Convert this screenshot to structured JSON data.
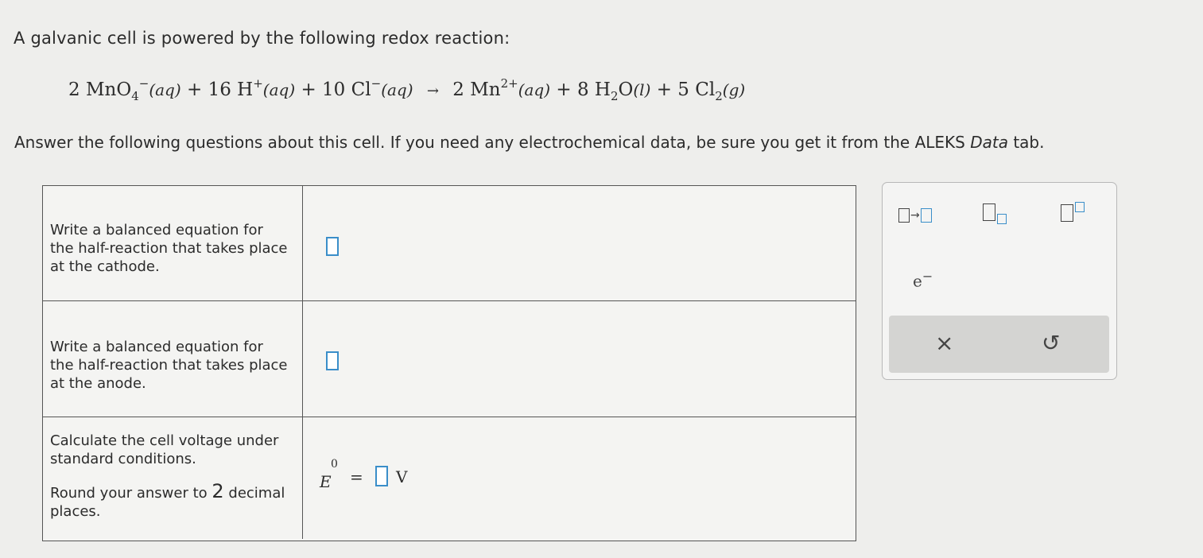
{
  "intro": "A galvanic cell is powered by the following redox reaction:",
  "reaction": {
    "r1_coef": "2",
    "r1_formula": "MnO",
    "r1_sub": "4",
    "r1_sup": "−",
    "r1_state": "(aq)",
    "plus1": "+",
    "r2_coef": "16",
    "r2_formula": "H",
    "r2_sup": "+",
    "r2_state": "(aq)",
    "plus2": "+",
    "r3_coef": "10",
    "r3_formula": "Cl",
    "r3_sup": "−",
    "r3_state": "(aq)",
    "arrow": "→",
    "p1_coef": "2",
    "p1_formula": "Mn",
    "p1_sup": "2+",
    "p1_state": "(aq)",
    "plus3": "+",
    "p2_coef": "8",
    "p2_formula_a": "H",
    "p2_sub": "2",
    "p2_formula_b": "O",
    "p2_state": "(l)",
    "plus4": "+",
    "p3_coef": "5",
    "p3_formula": "Cl",
    "p3_sub": "2",
    "p3_state": "(g)"
  },
  "instructions": {
    "before": "Answer the following questions about this cell. If you need any electrochemical data, be sure you get it from the ALEKS ",
    "data_word": "Data",
    "after": " tab."
  },
  "questions": [
    {
      "text": "Write a balanced equation for the half-reaction that takes place at the cathode."
    },
    {
      "text": "Write a balanced equation for the half-reaction that takes place at the anode."
    },
    {
      "text": "Calculate the cell voltage under standard conditions.",
      "round_before": "Round your answer to ",
      "round_num": "2",
      "round_after": " decimal places."
    }
  ],
  "voltage": {
    "symbol": "E",
    "superscript": "0",
    "equals": "=",
    "unit": "V"
  },
  "tools": {
    "arrow": "→",
    "electron_base": "e",
    "electron_sup": "−",
    "clear": "×",
    "undo": "↺"
  }
}
